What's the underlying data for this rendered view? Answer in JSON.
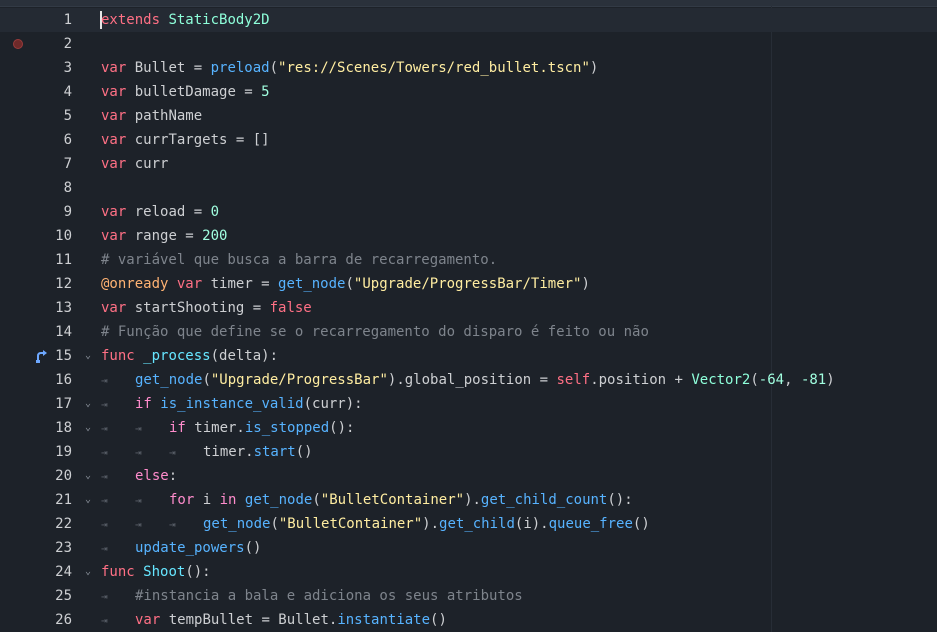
{
  "editor": {
    "lines": [
      {
        "n": "1",
        "current": true,
        "cursor": true,
        "indent": 0,
        "tokens": [
          [
            "kw",
            "extends"
          ],
          [
            "id",
            " "
          ],
          [
            "cls",
            "StaticBody2D"
          ]
        ]
      },
      {
        "n": "2",
        "breakpoint": true,
        "indent": 0,
        "tokens": []
      },
      {
        "n": "3",
        "indent": 0,
        "tokens": [
          [
            "kw",
            "var"
          ],
          [
            "id",
            " Bullet = "
          ],
          [
            "fn",
            "preload"
          ],
          [
            "id",
            "("
          ],
          [
            "str",
            "\"res://Scenes/Towers/red_bullet.tscn\""
          ],
          [
            "id",
            ")"
          ]
        ]
      },
      {
        "n": "4",
        "indent": 0,
        "tokens": [
          [
            "kw",
            "var"
          ],
          [
            "id",
            " bulletDamage = "
          ],
          [
            "num",
            "5"
          ]
        ]
      },
      {
        "n": "5",
        "indent": 0,
        "tokens": [
          [
            "kw",
            "var"
          ],
          [
            "id",
            " pathName"
          ]
        ]
      },
      {
        "n": "6",
        "indent": 0,
        "tokens": [
          [
            "kw",
            "var"
          ],
          [
            "id",
            " currTargets = []"
          ]
        ]
      },
      {
        "n": "7",
        "indent": 0,
        "tokens": [
          [
            "kw",
            "var"
          ],
          [
            "id",
            " curr"
          ]
        ]
      },
      {
        "n": "8",
        "indent": 0,
        "tokens": []
      },
      {
        "n": "9",
        "indent": 0,
        "tokens": [
          [
            "kw",
            "var"
          ],
          [
            "id",
            " reload = "
          ],
          [
            "num",
            "0"
          ]
        ]
      },
      {
        "n": "10",
        "indent": 0,
        "tokens": [
          [
            "kw",
            "var"
          ],
          [
            "id",
            " range = "
          ],
          [
            "num",
            "200"
          ]
        ]
      },
      {
        "n": "11",
        "indent": 0,
        "tokens": [
          [
            "cm",
            "# variável que busca a barra de recarregamento."
          ]
        ]
      },
      {
        "n": "12",
        "indent": 0,
        "tokens": [
          [
            "an",
            "@onready"
          ],
          [
            "id",
            " "
          ],
          [
            "kw",
            "var"
          ],
          [
            "id",
            " timer = "
          ],
          [
            "fn",
            "get_node"
          ],
          [
            "id",
            "("
          ],
          [
            "str",
            "\"Upgrade/ProgressBar/Timer\""
          ],
          [
            "id",
            ")"
          ]
        ]
      },
      {
        "n": "13",
        "indent": 0,
        "tokens": [
          [
            "kw",
            "var"
          ],
          [
            "id",
            " startShooting = "
          ],
          [
            "kw",
            "false"
          ]
        ]
      },
      {
        "n": "14",
        "indent": 0,
        "tokens": [
          [
            "cm",
            "# Função que define se o recarregamento do disparo é feito ou não"
          ]
        ]
      },
      {
        "n": "15",
        "exec": true,
        "fold": true,
        "indent": 0,
        "tokens": [
          [
            "kw",
            "func"
          ],
          [
            "id",
            " "
          ],
          [
            "fnd",
            "_process"
          ],
          [
            "id",
            "(delta):"
          ]
        ]
      },
      {
        "n": "16",
        "indent": 1,
        "tokens": [
          [
            "fn",
            "get_node"
          ],
          [
            "id",
            "("
          ],
          [
            "str",
            "\"Upgrade/ProgressBar\""
          ],
          [
            "id",
            ").global_position = "
          ],
          [
            "kw",
            "self"
          ],
          [
            "id",
            ".position + "
          ],
          [
            "cls",
            "Vector2"
          ],
          [
            "id",
            "("
          ],
          [
            "num",
            "-64"
          ],
          [
            "id",
            ", "
          ],
          [
            "num",
            "-81"
          ],
          [
            "id",
            ")"
          ]
        ]
      },
      {
        "n": "17",
        "fold": true,
        "indent": 1,
        "tokens": [
          [
            "kw2",
            "if"
          ],
          [
            "id",
            " "
          ],
          [
            "fn",
            "is_instance_valid"
          ],
          [
            "id",
            "(curr):"
          ]
        ]
      },
      {
        "n": "18",
        "fold": true,
        "indent": 2,
        "tokens": [
          [
            "kw2",
            "if"
          ],
          [
            "id",
            " timer."
          ],
          [
            "fn",
            "is_stopped"
          ],
          [
            "id",
            "():"
          ]
        ]
      },
      {
        "n": "19",
        "indent": 3,
        "tokens": [
          [
            "id",
            "timer."
          ],
          [
            "fn",
            "start"
          ],
          [
            "id",
            "()"
          ]
        ]
      },
      {
        "n": "20",
        "fold": true,
        "indent": 1,
        "tokens": [
          [
            "kw2",
            "else"
          ],
          [
            "id",
            ":"
          ]
        ]
      },
      {
        "n": "21",
        "fold": true,
        "indent": 2,
        "tokens": [
          [
            "kw2",
            "for"
          ],
          [
            "id",
            " i "
          ],
          [
            "kw2",
            "in"
          ],
          [
            "id",
            " "
          ],
          [
            "fn",
            "get_node"
          ],
          [
            "id",
            "("
          ],
          [
            "str",
            "\"BulletContainer\""
          ],
          [
            "id",
            ")."
          ],
          [
            "fn",
            "get_child_count"
          ],
          [
            "id",
            "():"
          ]
        ]
      },
      {
        "n": "22",
        "indent": 3,
        "tokens": [
          [
            "fn",
            "get_node"
          ],
          [
            "id",
            "("
          ],
          [
            "str",
            "\"BulletContainer\""
          ],
          [
            "id",
            ")."
          ],
          [
            "fn",
            "get_child"
          ],
          [
            "id",
            "(i)."
          ],
          [
            "fn",
            "queue_free"
          ],
          [
            "id",
            "()"
          ]
        ]
      },
      {
        "n": "23",
        "indent": 1,
        "tokens": [
          [
            "fn",
            "update_powers"
          ],
          [
            "id",
            "()"
          ]
        ]
      },
      {
        "n": "24",
        "fold": true,
        "indent": 0,
        "tokens": [
          [
            "kw",
            "func"
          ],
          [
            "id",
            " "
          ],
          [
            "fnd",
            "Shoot"
          ],
          [
            "id",
            "():"
          ]
        ]
      },
      {
        "n": "25",
        "indent": 1,
        "tokens": [
          [
            "cm",
            "#instancia a bala e adiciona os seus atributos"
          ]
        ]
      },
      {
        "n": "26",
        "indent": 1,
        "tokens": [
          [
            "kw",
            "var"
          ],
          [
            "id",
            " tempBullet = Bullet."
          ],
          [
            "fn",
            "instantiate"
          ],
          [
            "id",
            "()"
          ]
        ]
      }
    ],
    "tab_glyph": "⇥",
    "fold_glyph": "⌄",
    "colors": {
      "background": "#1d2229",
      "keyword": "#ff7085",
      "control_keyword": "#ff8ccc",
      "class": "#8effda",
      "string": "#ffeda1",
      "number": "#a1ffe0",
      "function": "#57b3ff",
      "comment": "#7e848c",
      "annotation": "#ffb373"
    }
  }
}
